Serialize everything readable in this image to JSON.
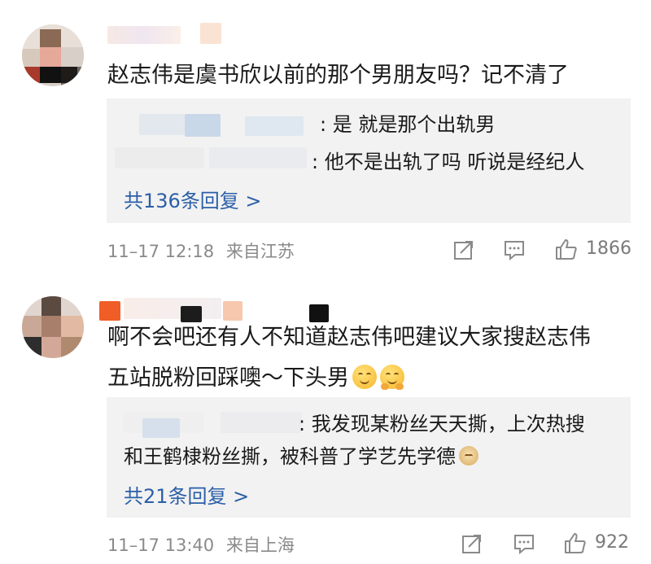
{
  "comments": [
    {
      "text": "赵志伟是虞书欣以前的那个男朋友吗？记不清了",
      "replies": [
        {
          "text": ": 是 就是那个出轨男"
        },
        {
          "text": ": 他不是出轨了吗 听说是经纪人"
        }
      ],
      "more_replies": "共136条回复 >",
      "time": "11–17 12:18",
      "location": "来自江苏",
      "likes": "1866"
    },
    {
      "text_line1": "啊不会吧还有人不知道赵志伟吧建议大家搜赵志伟",
      "text_line2": "五站脱粉回踩噢～下头男",
      "replies": [
        {
          "text_line1": ": 我发现某粉丝天天撕，上次热搜",
          "text_line2": "和王鹤棣粉丝撕，被科普了学艺先学德"
        }
      ],
      "more_replies": "共21条回复 >",
      "time": "11–17 13:40",
      "location": "来自上海",
      "likes": "922"
    }
  ],
  "icons": [
    "share-icon",
    "comment-icon",
    "like-icon",
    "smile-emoji-icon",
    "hug-emoji-icon",
    "doge-emoji-icon"
  ],
  "colors": {
    "link": "#2b5fa8",
    "meta": "#8a8a8a",
    "reply_bg": "#f2f2f2"
  }
}
